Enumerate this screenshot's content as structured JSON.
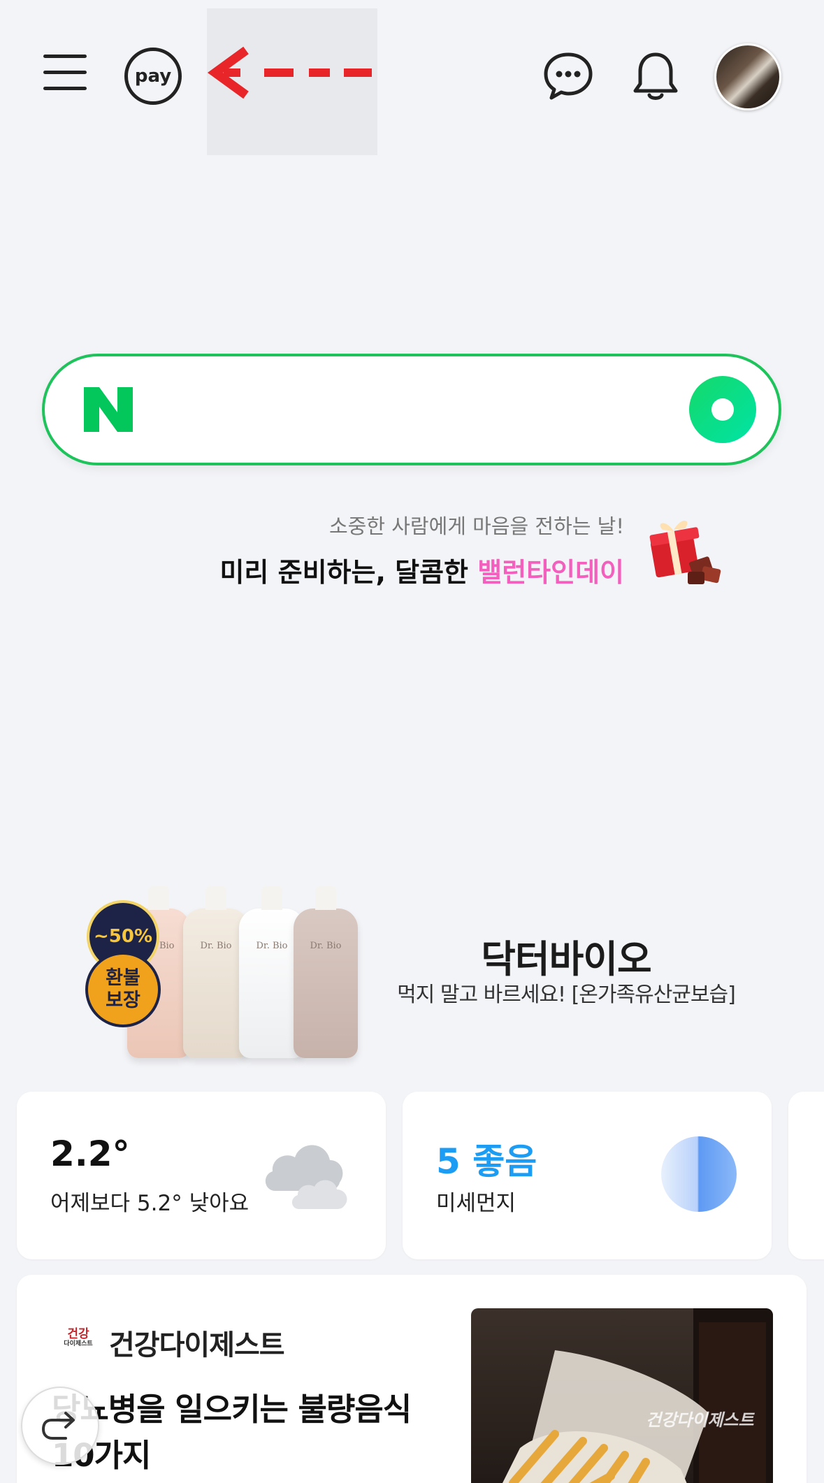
{
  "header": {
    "menu_icon": "hamburger-icon",
    "pay_label": "pay",
    "overlay_icon": "red-dashed-left-arrow-icon",
    "talk_icon": "chat-bubble-icon",
    "notification_icon": "bell-icon",
    "avatar_icon": "profile-photo"
  },
  "search": {
    "brand_logo": "N",
    "brand_color": "#03c75a",
    "placeholder": "",
    "lens_icon": "green-lens-icon"
  },
  "promo": {
    "subtitle": "소중한 사람에게 마음을 전하는 날!",
    "title_prefix": "미리 준비하는, 달콤한 ",
    "title_highlight": "밸런타인데이",
    "highlight_color": "#f25fbd",
    "icon": "gift-box-icon"
  },
  "ad": {
    "badge_discount": "~50%",
    "badge_refund_line1": "환불",
    "badge_refund_line2": "보장",
    "bottle_labels": [
      "Dr. Bio",
      "Dr. Bio",
      "Dr. Bio",
      "Dr. Bio"
    ],
    "brand": "닥터바이오",
    "description": "먹지 말고 바르세요! [온가족유산균보습]"
  },
  "weather": {
    "temperature": "2.2°",
    "comparison": "어제보다 5.2° 낮아요",
    "icon": "cloudy-icon"
  },
  "air_quality": {
    "value": "5 좋음",
    "label": "미세먼지",
    "value_color": "#1c9cf3",
    "icon": "half-circle-gauge-icon"
  },
  "news": {
    "logo_text": "건강",
    "logo_subtext": "다이제스트",
    "source": "건강다이제스트",
    "title": "당뇨병을 일으키는 불량음식 10가지",
    "thumbnail_watermark": "건강다이제스트"
  },
  "floating": {
    "icon": "curved-back-arrow-icon"
  }
}
